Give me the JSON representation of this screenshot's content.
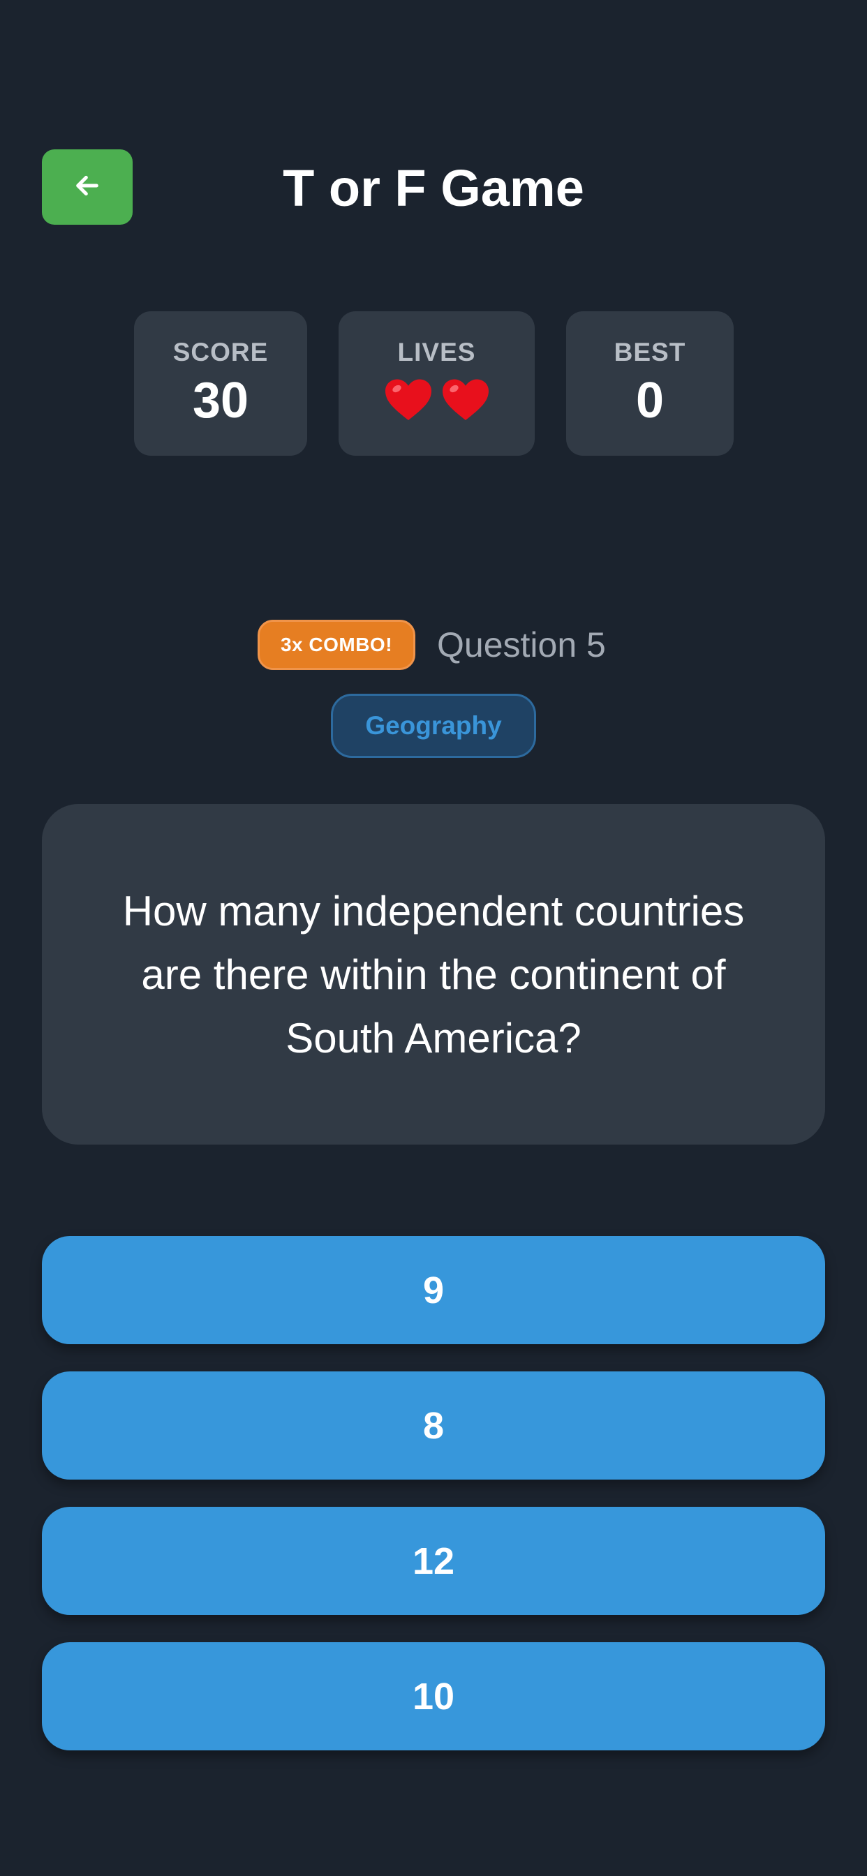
{
  "header": {
    "title": "T or F Game",
    "back_icon": "arrow-left-icon"
  },
  "stats": {
    "score": {
      "label": "SCORE",
      "value": "30"
    },
    "lives": {
      "label": "LIVES",
      "count": 2,
      "icon": "heart-icon",
      "color": "#e8101c"
    },
    "best": {
      "label": "BEST",
      "value": "0"
    }
  },
  "status": {
    "combo": "3x COMBO!",
    "question_number": "Question 5",
    "category": "Geography"
  },
  "question": {
    "text": "How many independent countries are there within the continent of South America?"
  },
  "answers": [
    "9",
    "8",
    "12",
    "10"
  ],
  "colors": {
    "background": "#1b232e",
    "card": "#313a45",
    "back_button": "#4caf50",
    "combo": "#e67e22",
    "answer": "#3797db",
    "category_text": "#3a95d9"
  }
}
